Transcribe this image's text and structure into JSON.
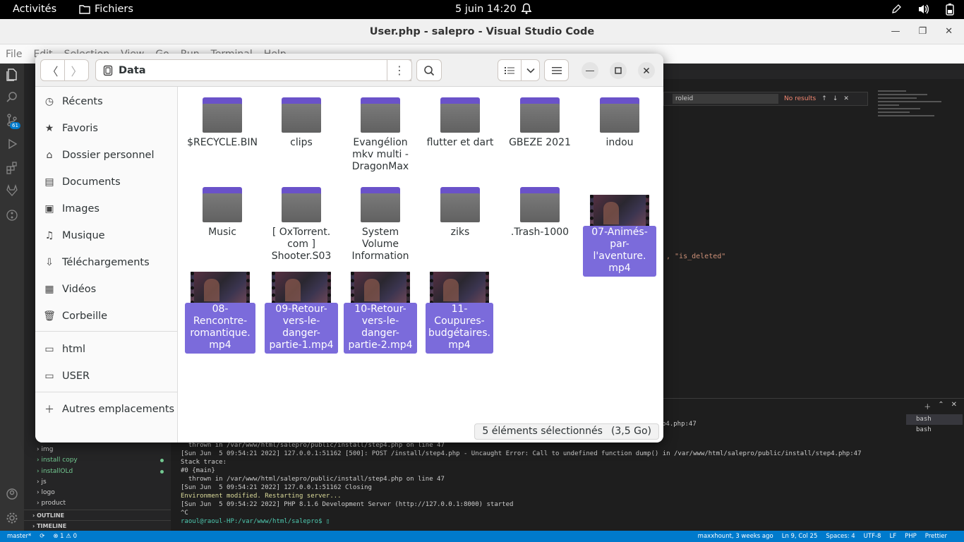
{
  "topbar": {
    "activities": "Activités",
    "app_name": "Fichiers",
    "clock": "5 juin  14:20"
  },
  "vscode": {
    "window_title": "User.php - salepro - Visual Studio Code",
    "menu": [
      "File",
      "Edit",
      "Selection",
      "View",
      "Go",
      "Run",
      "Terminal",
      "Help"
    ],
    "badge_count": "61",
    "find": {
      "value": "roleid",
      "result": "No results"
    },
    "editor_snippet": ", \"is_deleted\"",
    "tree": [
      {
        "label": "img",
        "modified": false
      },
      {
        "label": "install copy",
        "modified": true
      },
      {
        "label": "installOLd",
        "modified": true
      },
      {
        "label": "js",
        "modified": false
      },
      {
        "label": "logo",
        "modified": false
      },
      {
        "label": "product",
        "modified": false
      }
    ],
    "sections": {
      "outline": "OUTLINE",
      "timeline": "TIMELINE"
    },
    "terminal": {
      "partial": "p4.php:47",
      "lines": [
        {
          "text": "  thrown in /var/www/html/salepro/public/install/step4.php on line 47",
          "color": ""
        },
        {
          "text": "[Sun Jun  5 09:54:21 2022] 127.0.0.1:51162 [500]: POST /install/step4.php - Uncaught Error: Call to undefined function dump() in /var/www/html/salepro/public/install/step4.php:47",
          "color": ""
        },
        {
          "text": "Stack trace:",
          "color": ""
        },
        {
          "text": "#0 {main}",
          "color": ""
        },
        {
          "text": "  thrown in /var/www/html/salepro/public/install/step4.php on line 47",
          "color": ""
        },
        {
          "text": "[Sun Jun  5 09:54:21 2022] 127.0.0.1:51162 Closing",
          "color": ""
        },
        {
          "text": "Environment modified. Restarting server...",
          "color": "y"
        },
        {
          "text": "[Sun Jun  5 09:54:22 2022] PHP 8.1.6 Development Server (http://127.0.0.1:8000) started",
          "color": ""
        },
        {
          "text": "^C",
          "color": ""
        },
        {
          "text": "raoul@raoul-HP:/var/www/html/salepro$ ▯",
          "color": "g"
        }
      ],
      "shells": [
        "bash",
        "bash"
      ]
    },
    "status": {
      "branch": "master*",
      "problems": "⊗ 1 ⚠ 0",
      "blame": "maxxhount, 3 weeks ago",
      "position": "Ln 9, Col 25",
      "spaces": "Spaces: 4",
      "encoding": "UTF-8",
      "eol": "LF",
      "language": "PHP",
      "formatter": "Prettier"
    }
  },
  "files": {
    "location": "Data",
    "sidebar": [
      {
        "label": "Récents",
        "icon": "clock-icon"
      },
      {
        "label": "Favoris",
        "icon": "star-icon"
      },
      {
        "label": "Dossier personnel",
        "icon": "home-icon"
      },
      {
        "label": "Documents",
        "icon": "document-icon"
      },
      {
        "label": "Images",
        "icon": "image-icon"
      },
      {
        "label": "Musique",
        "icon": "music-icon"
      },
      {
        "label": "Téléchargements",
        "icon": "download-icon"
      },
      {
        "label": "Vidéos",
        "icon": "video-icon"
      },
      {
        "label": "Corbeille",
        "icon": "trash-icon"
      },
      {
        "label": "html",
        "icon": "folder-icon"
      },
      {
        "label": "USER",
        "icon": "folder-icon"
      },
      {
        "label": "Autres emplacements",
        "icon": "plus-icon"
      }
    ],
    "items": [
      {
        "name": "$RECYCLE.BIN",
        "kind": "folder",
        "selected": false
      },
      {
        "name": "clips",
        "kind": "folder",
        "selected": false
      },
      {
        "name": "Evangélion mkv multi - DragonMax",
        "kind": "folder",
        "selected": false
      },
      {
        "name": "flutter et dart",
        "kind": "folder",
        "selected": false
      },
      {
        "name": "GBEZE 2021",
        "kind": "folder",
        "selected": false
      },
      {
        "name": "indou",
        "kind": "folder",
        "selected": false
      },
      {
        "name": "Music",
        "kind": "folder",
        "selected": false
      },
      {
        "name": "[ OxTorrent. com ] Shooter.S03",
        "kind": "folder",
        "selected": false
      },
      {
        "name": "System Volume Information",
        "kind": "folder",
        "selected": false
      },
      {
        "name": "ziks",
        "kind": "folder",
        "selected": false
      },
      {
        "name": ".Trash-1000",
        "kind": "folder",
        "selected": false
      },
      {
        "name": "07-Animés-par-l'aventure. mp4",
        "kind": "video",
        "selected": true
      },
      {
        "name": "08-Rencontre-romantique. mp4",
        "kind": "video",
        "selected": true
      },
      {
        "name": "09-Retour-vers-le-danger-partie-1.mp4",
        "kind": "video",
        "selected": true
      },
      {
        "name": "10-Retour-vers-le-danger-partie-2.mp4",
        "kind": "video",
        "selected": true
      },
      {
        "name": "11-Coupures-budgétaires. mp4",
        "kind": "video",
        "selected": true
      }
    ],
    "selection_status": "5 éléments sélectionnés",
    "selection_size": "(3,5 Go)"
  }
}
